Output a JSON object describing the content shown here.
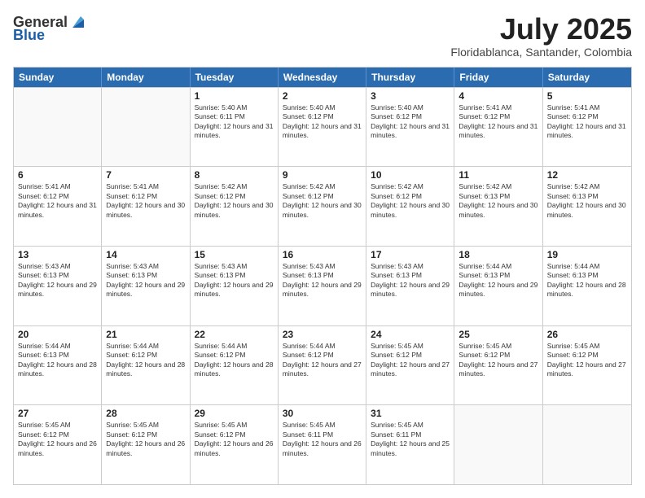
{
  "logo": {
    "general": "General",
    "blue": "Blue"
  },
  "title": {
    "month_year": "July 2025",
    "location": "Floridablanca, Santander, Colombia"
  },
  "weekdays": [
    "Sunday",
    "Monday",
    "Tuesday",
    "Wednesday",
    "Thursday",
    "Friday",
    "Saturday"
  ],
  "rows": [
    [
      {
        "day": "",
        "info": ""
      },
      {
        "day": "",
        "info": ""
      },
      {
        "day": "1",
        "info": "Sunrise: 5:40 AM\nSunset: 6:11 PM\nDaylight: 12 hours and 31 minutes."
      },
      {
        "day": "2",
        "info": "Sunrise: 5:40 AM\nSunset: 6:12 PM\nDaylight: 12 hours and 31 minutes."
      },
      {
        "day": "3",
        "info": "Sunrise: 5:40 AM\nSunset: 6:12 PM\nDaylight: 12 hours and 31 minutes."
      },
      {
        "day": "4",
        "info": "Sunrise: 5:41 AM\nSunset: 6:12 PM\nDaylight: 12 hours and 31 minutes."
      },
      {
        "day": "5",
        "info": "Sunrise: 5:41 AM\nSunset: 6:12 PM\nDaylight: 12 hours and 31 minutes."
      }
    ],
    [
      {
        "day": "6",
        "info": "Sunrise: 5:41 AM\nSunset: 6:12 PM\nDaylight: 12 hours and 31 minutes."
      },
      {
        "day": "7",
        "info": "Sunrise: 5:41 AM\nSunset: 6:12 PM\nDaylight: 12 hours and 30 minutes."
      },
      {
        "day": "8",
        "info": "Sunrise: 5:42 AM\nSunset: 6:12 PM\nDaylight: 12 hours and 30 minutes."
      },
      {
        "day": "9",
        "info": "Sunrise: 5:42 AM\nSunset: 6:12 PM\nDaylight: 12 hours and 30 minutes."
      },
      {
        "day": "10",
        "info": "Sunrise: 5:42 AM\nSunset: 6:12 PM\nDaylight: 12 hours and 30 minutes."
      },
      {
        "day": "11",
        "info": "Sunrise: 5:42 AM\nSunset: 6:13 PM\nDaylight: 12 hours and 30 minutes."
      },
      {
        "day": "12",
        "info": "Sunrise: 5:42 AM\nSunset: 6:13 PM\nDaylight: 12 hours and 30 minutes."
      }
    ],
    [
      {
        "day": "13",
        "info": "Sunrise: 5:43 AM\nSunset: 6:13 PM\nDaylight: 12 hours and 29 minutes."
      },
      {
        "day": "14",
        "info": "Sunrise: 5:43 AM\nSunset: 6:13 PM\nDaylight: 12 hours and 29 minutes."
      },
      {
        "day": "15",
        "info": "Sunrise: 5:43 AM\nSunset: 6:13 PM\nDaylight: 12 hours and 29 minutes."
      },
      {
        "day": "16",
        "info": "Sunrise: 5:43 AM\nSunset: 6:13 PM\nDaylight: 12 hours and 29 minutes."
      },
      {
        "day": "17",
        "info": "Sunrise: 5:43 AM\nSunset: 6:13 PM\nDaylight: 12 hours and 29 minutes."
      },
      {
        "day": "18",
        "info": "Sunrise: 5:44 AM\nSunset: 6:13 PM\nDaylight: 12 hours and 29 minutes."
      },
      {
        "day": "19",
        "info": "Sunrise: 5:44 AM\nSunset: 6:13 PM\nDaylight: 12 hours and 28 minutes."
      }
    ],
    [
      {
        "day": "20",
        "info": "Sunrise: 5:44 AM\nSunset: 6:13 PM\nDaylight: 12 hours and 28 minutes."
      },
      {
        "day": "21",
        "info": "Sunrise: 5:44 AM\nSunset: 6:12 PM\nDaylight: 12 hours and 28 minutes."
      },
      {
        "day": "22",
        "info": "Sunrise: 5:44 AM\nSunset: 6:12 PM\nDaylight: 12 hours and 28 minutes."
      },
      {
        "day": "23",
        "info": "Sunrise: 5:44 AM\nSunset: 6:12 PM\nDaylight: 12 hours and 27 minutes."
      },
      {
        "day": "24",
        "info": "Sunrise: 5:45 AM\nSunset: 6:12 PM\nDaylight: 12 hours and 27 minutes."
      },
      {
        "day": "25",
        "info": "Sunrise: 5:45 AM\nSunset: 6:12 PM\nDaylight: 12 hours and 27 minutes."
      },
      {
        "day": "26",
        "info": "Sunrise: 5:45 AM\nSunset: 6:12 PM\nDaylight: 12 hours and 27 minutes."
      }
    ],
    [
      {
        "day": "27",
        "info": "Sunrise: 5:45 AM\nSunset: 6:12 PM\nDaylight: 12 hours and 26 minutes."
      },
      {
        "day": "28",
        "info": "Sunrise: 5:45 AM\nSunset: 6:12 PM\nDaylight: 12 hours and 26 minutes."
      },
      {
        "day": "29",
        "info": "Sunrise: 5:45 AM\nSunset: 6:12 PM\nDaylight: 12 hours and 26 minutes."
      },
      {
        "day": "30",
        "info": "Sunrise: 5:45 AM\nSunset: 6:11 PM\nDaylight: 12 hours and 26 minutes."
      },
      {
        "day": "31",
        "info": "Sunrise: 5:45 AM\nSunset: 6:11 PM\nDaylight: 12 hours and 25 minutes."
      },
      {
        "day": "",
        "info": ""
      },
      {
        "day": "",
        "info": ""
      }
    ]
  ]
}
